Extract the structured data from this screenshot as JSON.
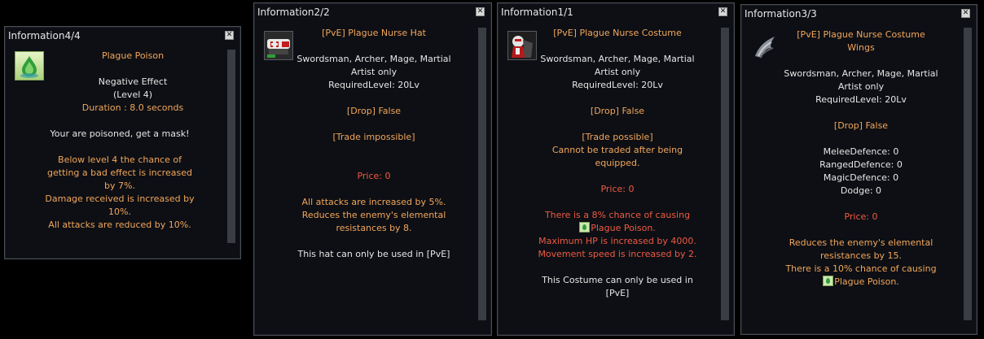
{
  "windows": [
    {
      "title": "Information4/4",
      "icon": "plague-poison-icon",
      "header": "Plague Poison",
      "effect_type": "Negative Effect",
      "level": "(Level 4)",
      "duration": "Duration : 8.0 seconds",
      "flavor": "Your are poisoned, get a mask!",
      "effects": [
        "Below level 4 the chance of",
        "getting a bad effect is increased",
        "by 7%.",
        "Damage received is increased by",
        "10%.",
        "All attacks are reduced by 10%."
      ]
    },
    {
      "title": "Information2/2",
      "icon": "plague-nurse-hat-icon",
      "name": "[PvE] Plague Nurse Hat",
      "classes": [
        "Swordsman, Archer, Mage, Martial",
        "Artist only"
      ],
      "required_level": "RequiredLevel: 20Lv",
      "drop": "[Drop] False",
      "trade": "[Trade impossible]",
      "price": "Price: 0",
      "effects": [
        "All attacks are increased by 5%.",
        "Reduces the enemy's elemental",
        "resistances by 8."
      ],
      "note": "This hat can only be used in [PvE]"
    },
    {
      "title": "Information1/1",
      "icon": "plague-nurse-costume-icon",
      "name": "[PvE] Plague Nurse Costume",
      "classes": [
        "Swordsman, Archer, Mage, Martial",
        "Artist only"
      ],
      "required_level": "RequiredLevel: 20Lv",
      "drop": "[Drop] False",
      "trade": "[Trade possible]",
      "trade_note": [
        "Cannot be traded after being",
        "equipped."
      ],
      "price": "Price: 0",
      "effects_pre": "There is a 8% chance of causing",
      "effect_link": "Plague Poison.",
      "effects": [
        "Maximum HP is increased by 4000.",
        "Movement speed is increased by 2."
      ],
      "note": [
        "This Costume can only be used in",
        "[PvE]"
      ]
    },
    {
      "title": "Information3/3",
      "icon": "plague-nurse-costume-wings-icon",
      "name": [
        "[PvE] Plague Nurse Costume",
        "Wings"
      ],
      "classes": [
        "Swordsman, Archer, Mage, Martial",
        "Artist only"
      ],
      "required_level": "RequiredLevel: 20Lv",
      "drop": "[Drop] False",
      "stats": [
        "MeleeDefence: 0",
        "RangedDefence: 0",
        "MagicDefence: 0",
        "Dodge: 0"
      ],
      "price": "Price: 0",
      "effects": [
        "Reduces the enemy's elemental",
        "resistances by 15.",
        "There is a 10% chance of causing"
      ],
      "effect_link": "Plague Poison."
    }
  ],
  "close_glyph": "✕",
  "colors": {
    "orange": "#f2a65b",
    "white": "#e6e6e6",
    "red": "#ef5a43",
    "panel": "#0d0f14"
  }
}
